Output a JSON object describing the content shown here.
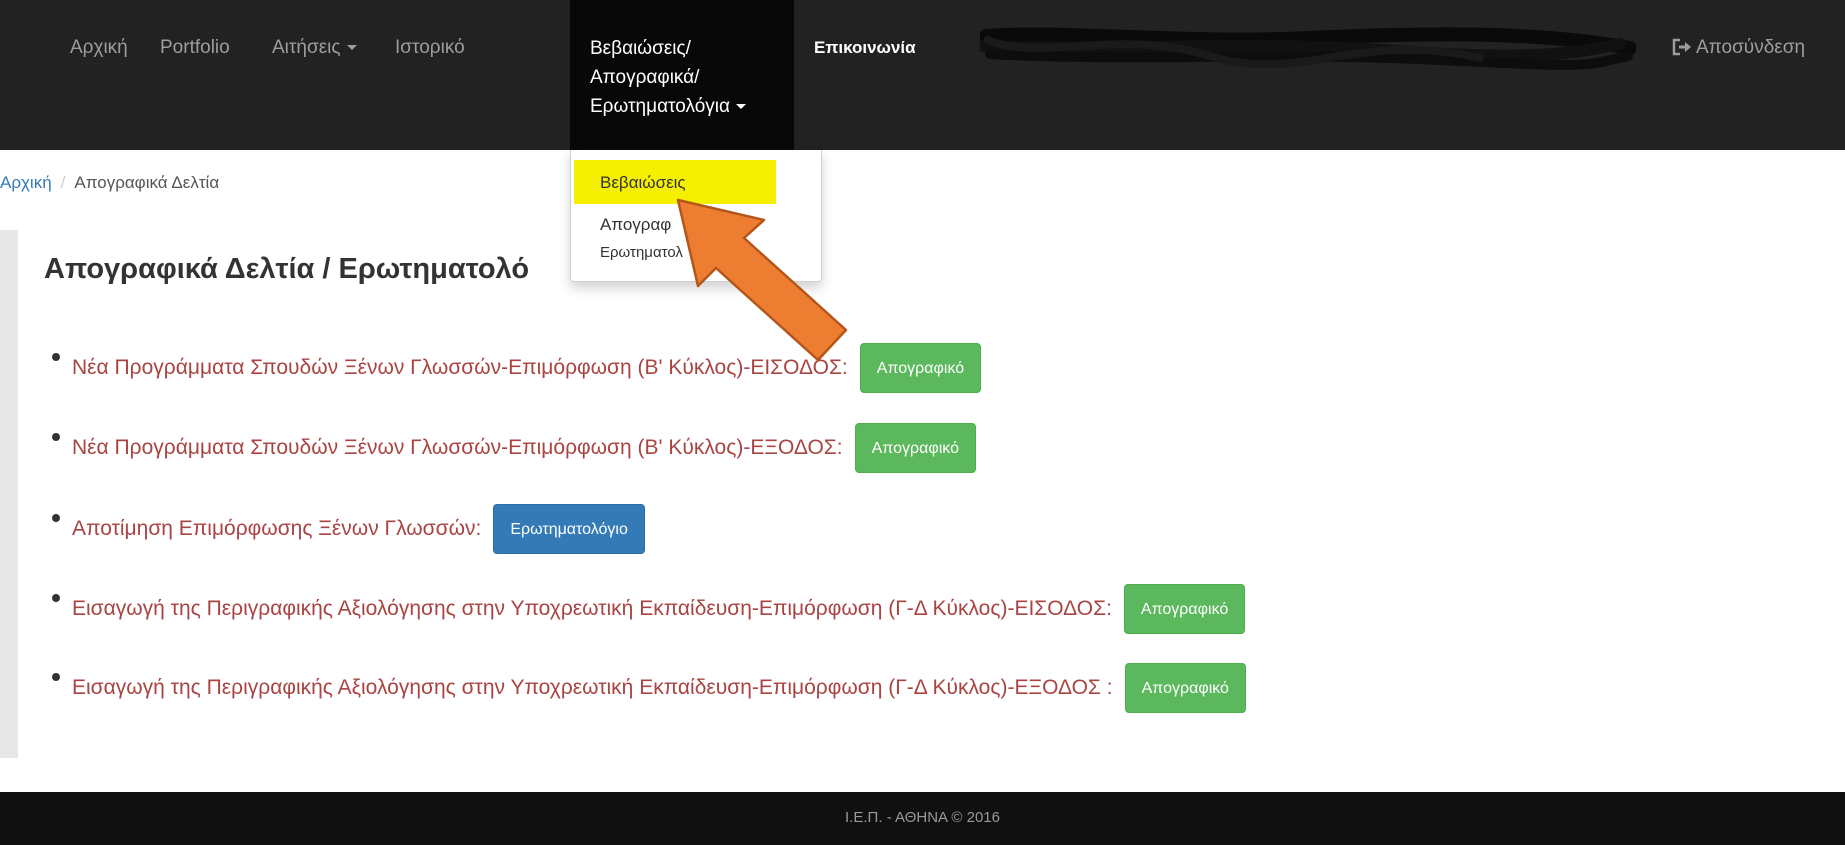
{
  "navbar": {
    "items": [
      {
        "label": "Αρχική"
      },
      {
        "label": "Portfolio"
      },
      {
        "label": "Αιτήσεις"
      },
      {
        "label": "Ιστορικό"
      }
    ],
    "active_menu": {
      "line1": "Βεβαιώσεις/",
      "line2": "Απογραφικά/",
      "line3": "Ερωτηματολόγια"
    },
    "contact": "Επικοινωνία",
    "logout": "Αποσύνδεση"
  },
  "dropdown": {
    "items": [
      {
        "label": "Βεβαιώσεις"
      },
      {
        "label": "Απογραφ"
      },
      {
        "label": "Ερωτηματολ"
      }
    ]
  },
  "breadcrumb": {
    "home": "Αρχική",
    "separator": "/",
    "current": "Απογραφικά Δελτία"
  },
  "page_title": "Απογραφικά Δελτία / Ερωτηματολό",
  "list": [
    {
      "text": "Νέα Προγράμματα Σπουδών Ξένων Γλωσσών-Επιμόρφωση (Β' Κύκλος)-ΕΙΣΟΔΟΣ:",
      "button": "Απογραφικό"
    },
    {
      "text": "Νέα Προγράμματα Σπουδών Ξένων Γλωσσών-Επιμόρφωση (Β' Κύκλος)-ΕΞΟΔΟΣ:",
      "button": "Απογραφικό"
    },
    {
      "text": "Αποτίμηση Επιμόρφωσης Ξένων Γλωσσών:",
      "button": "Ερωτηματολόγιο"
    },
    {
      "text": "Εισαγωγή της Περιγραφικής Αξιολόγησης στην Υποχρεωτική Εκπαίδευση-Επιμόρφωση (Γ-Δ Κύκλος)-ΕΙΣΟΔΟΣ:",
      "button": "Απογραφικό"
    },
    {
      "text": "Εισαγωγή της Περιγραφικής Αξιολόγησης στην Υποχρεωτική Εκπαίδευση-Επιμόρφωση (Γ-Δ Κύκλος)-ΕΞΟΔΟΣ :",
      "button": "Απογραφικό"
    }
  ],
  "footer": "Ι.Ε.Π. - ΑΘΗΝΑ © 2016",
  "colors": {
    "navbar": "#222222",
    "link": "#337ab7",
    "list_text": "#a94442",
    "success": "#5cb85c",
    "primary": "#337ab7",
    "highlight": "#f5f000",
    "arrow": "#ed7d31"
  },
  "icons": {
    "logout": "sign-out-icon",
    "arrow": "pointer-arrow-annotation"
  }
}
